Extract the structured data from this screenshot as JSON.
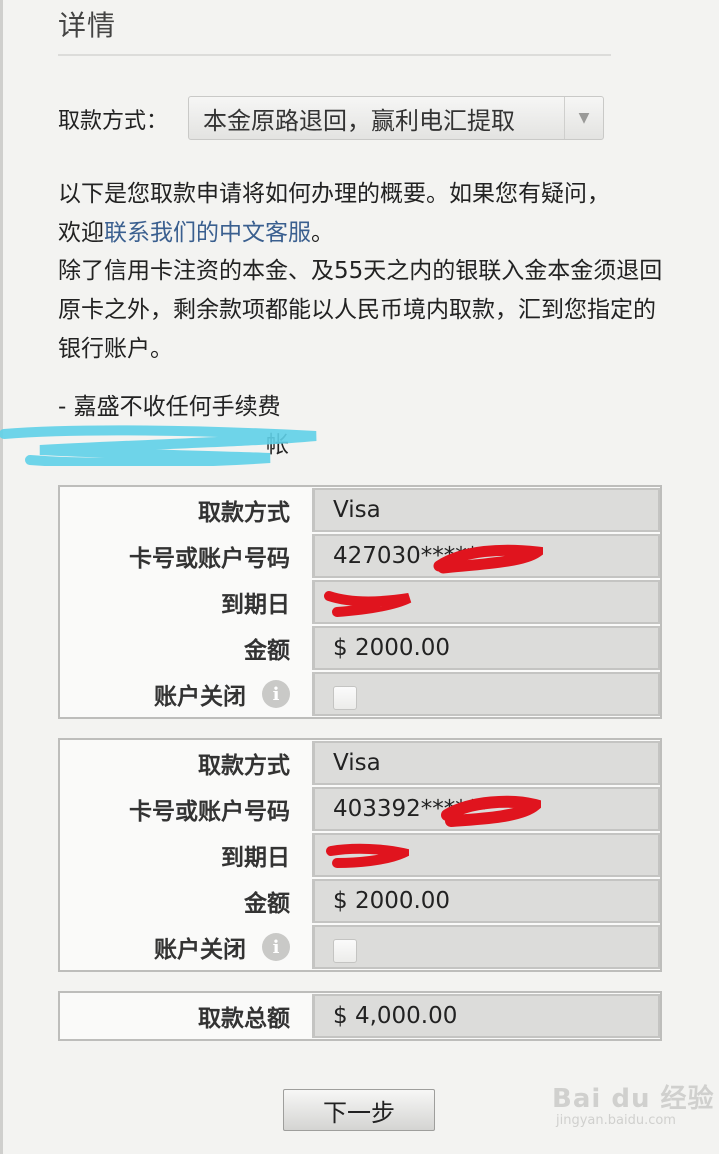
{
  "section": {
    "title": "详情"
  },
  "method": {
    "label": "取款方式：",
    "selected": "本金原路退回，赢利电汇提取"
  },
  "intro": {
    "line1": "以下是您取款申请将如何办理的概要。如果您有疑问，",
    "line2_prefix": "欢迎",
    "line2_link": "联系我们的中文客服",
    "line2_suffix": "。",
    "body": "除了信用卡注资的本金、及55天之内的银联入金本金须退回原卡之外，剩余款项都能以人民币境内取款，汇到您指定的银行账户。"
  },
  "fees": {
    "item1": "- 嘉盛不收任何手续费",
    "item2_visible": "帐"
  },
  "cards": [
    {
      "method_label": "取款方式",
      "method_value": "Visa",
      "number_label": "卡号或账户号码",
      "number_value": "427030*****",
      "expiry_label": "到期日",
      "expiry_value": "",
      "amount_label": "金额",
      "amount_value": "$ 2000.00",
      "close_label": "账户关闭"
    },
    {
      "method_label": "取款方式",
      "method_value": "Visa",
      "number_label": "卡号或账户号码",
      "number_value": "403392******",
      "expiry_label": "到期日",
      "expiry_value": "",
      "amount_label": "金额",
      "amount_value": "$ 2000.00",
      "close_label": "账户关闭"
    }
  ],
  "total": {
    "label": "取款总额",
    "value": "$ 4,000.00"
  },
  "next_button": "下一步",
  "watermark": {
    "main": "Bai du 经验",
    "sub": "jingyan.baidu.com"
  },
  "colors": {
    "link": "#3a5f8f",
    "redaction": "#e0141e",
    "scribble": "#5fd0e8"
  }
}
